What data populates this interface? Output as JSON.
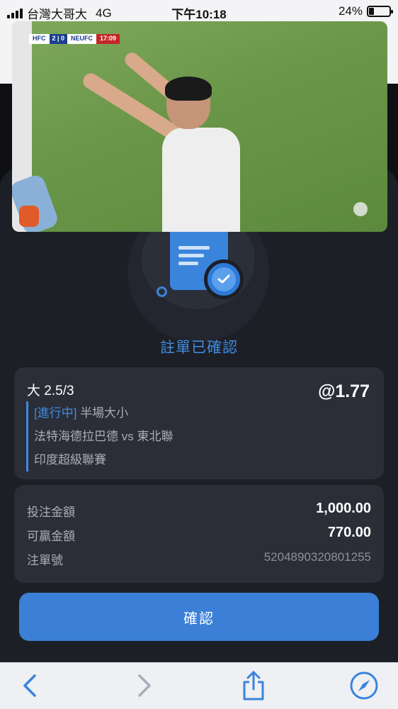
{
  "status_bar": {
    "carrier": "台灣大哥大",
    "network": "4G",
    "time": "下午10:18",
    "battery": "24%",
    "battery_level": 0.24
  },
  "video": {
    "home_team": "HFC",
    "score": "2 | 0",
    "away_team": "NEUFC",
    "match_time": "17:09"
  },
  "confirmation": {
    "title": "註單已確認"
  },
  "bet": {
    "selection": "大 2.5/3",
    "odds": "@1.77",
    "status_tag": "[進行中]",
    "market": "半場大小",
    "match": "法特海德拉巴德 vs 東北聯",
    "league": "印度超級聯賽"
  },
  "amounts": {
    "stake_label": "投注金額",
    "stake_value": "1,000.00",
    "win_label": "可贏金額",
    "win_value": "770.00",
    "ticket_label": "注單號",
    "ticket_value": "5204890320801255"
  },
  "buttons": {
    "confirm": "確認"
  },
  "toolbar": {
    "icons": [
      "back-icon",
      "forward-icon",
      "share-icon",
      "compass-icon"
    ]
  },
  "colors": {
    "accent": "#3f8be3",
    "sheet_bg": "#1d1f26",
    "card_bg": "#2b2e37",
    "button_bg": "#3b80d6"
  }
}
